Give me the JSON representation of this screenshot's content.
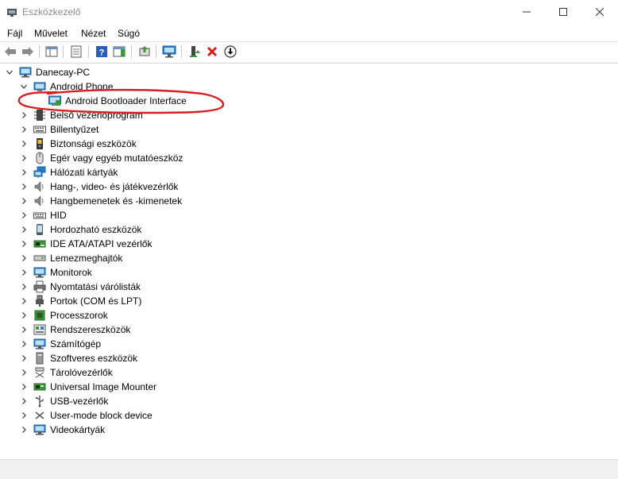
{
  "window": {
    "title": "Eszközkezelő"
  },
  "menu": [
    "Fájl",
    "Művelet",
    "Nézet",
    "Súgó"
  ],
  "tree": {
    "root": "Danecay-PC",
    "items": [
      {
        "label": "Android Phone",
        "icon": "android-phone-icon",
        "expanded": true,
        "children": [
          {
            "label": "Android Bootloader Interface",
            "icon": "bootloader-device-icon"
          }
        ]
      },
      {
        "label": "Belső vezérlőprogram",
        "icon": "firmware-icon"
      },
      {
        "label": "Billentyűzet",
        "icon": "keyboard-icon"
      },
      {
        "label": "Biztonsági eszközök",
        "icon": "security-device-icon"
      },
      {
        "label": "Egér vagy egyéb mutatóeszköz",
        "icon": "mouse-icon"
      },
      {
        "label": "Hálózati kártyák",
        "icon": "network-adapter-icon"
      },
      {
        "label": "Hang-, video- és játékvezérlők",
        "icon": "speaker-icon"
      },
      {
        "label": "Hangbemenetek és -kimenetek",
        "icon": "speaker-icon"
      },
      {
        "label": "HID",
        "icon": "hid-icon"
      },
      {
        "label": "Hordozható eszközök",
        "icon": "portable-device-icon"
      },
      {
        "label": "IDE ATA/ATAPI vezérlők",
        "icon": "ide-controller-icon"
      },
      {
        "label": "Lemezmeghajtók",
        "icon": "disk-drive-icon"
      },
      {
        "label": "Monitorok",
        "icon": "monitor-icon"
      },
      {
        "label": "Nyomtatási várólisták",
        "icon": "printer-icon"
      },
      {
        "label": "Portok (COM és LPT)",
        "icon": "port-icon"
      },
      {
        "label": "Processzorok",
        "icon": "processor-icon"
      },
      {
        "label": "Rendszereszközök",
        "icon": "system-device-icon"
      },
      {
        "label": "Számítógép",
        "icon": "computer-icon"
      },
      {
        "label": "Szoftveres eszközök",
        "icon": "software-device-icon"
      },
      {
        "label": "Tárolóvezérlők",
        "icon": "storage-controller-icon"
      },
      {
        "label": "Universal Image Mounter",
        "icon": "image-mounter-icon"
      },
      {
        "label": "USB-vezérlők",
        "icon": "usb-icon"
      },
      {
        "label": "User-mode block device",
        "icon": "block-device-icon"
      },
      {
        "label": "Videokártyák",
        "icon": "display-adapter-icon"
      }
    ]
  },
  "colors": {
    "annotation": "#d42020",
    "icon_blue": "#2a7fc9",
    "device_green": "#3a9a3a",
    "remove_red": "#d41f1f"
  }
}
